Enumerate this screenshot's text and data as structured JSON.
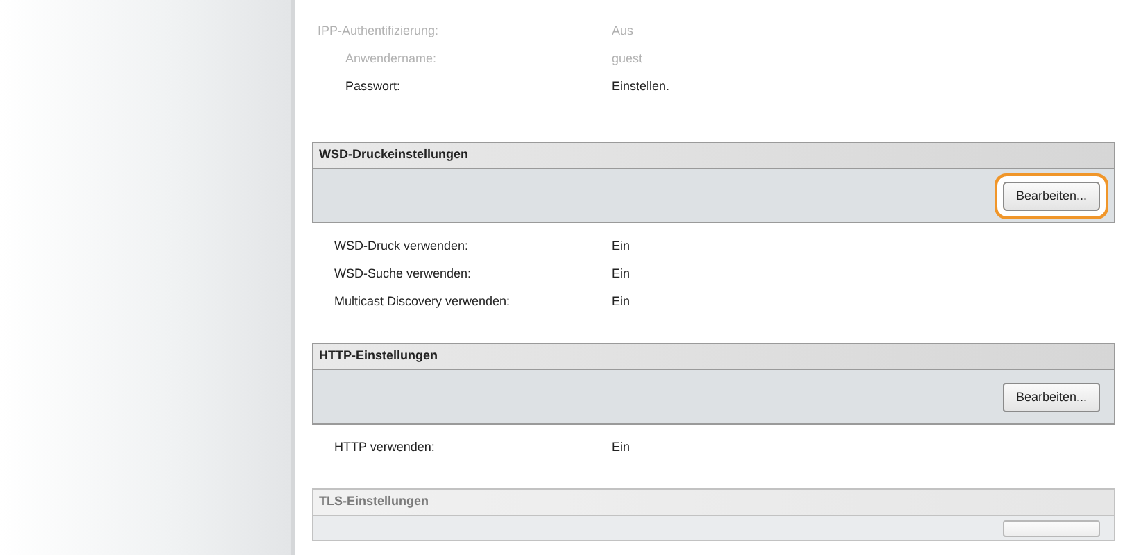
{
  "top_rows": [
    {
      "label": "IPP-Authentifizierung:",
      "value": "Aus",
      "faded": true,
      "children": [
        {
          "label": "Anwendername:",
          "value": "guest",
          "faded": true
        },
        {
          "label": "Passwort:",
          "value": "Einstellen.",
          "faded": false
        }
      ]
    }
  ],
  "sections": [
    {
      "title": "WSD-Druckeinstellungen",
      "faded": false,
      "button": {
        "label": "Bearbeiten...",
        "highlighted": true
      },
      "rows": [
        {
          "label": "WSD-Druck verwenden:",
          "value": "Ein"
        },
        {
          "label": "WSD-Suche verwenden:",
          "value": "Ein"
        },
        {
          "label": "Multicast Discovery verwenden:",
          "value": "Ein"
        }
      ]
    },
    {
      "title": "HTTP-Einstellungen",
      "faded": false,
      "button": {
        "label": "Bearbeiten...",
        "highlighted": false
      },
      "rows": [
        {
          "label": "HTTP verwenden:",
          "value": "Ein"
        }
      ]
    },
    {
      "title": "TLS-Einstellungen",
      "faded": true,
      "button": {
        "highlighted": false
      }
    }
  ]
}
